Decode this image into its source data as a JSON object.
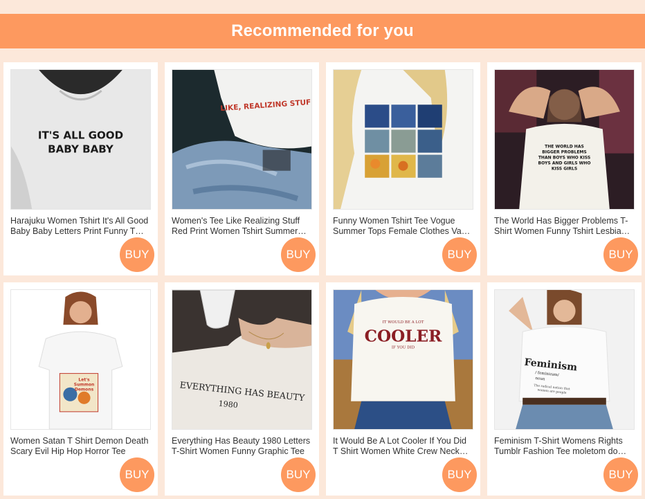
{
  "header": {
    "title": "Recommended for you"
  },
  "colors": {
    "accent": "#fd995f",
    "background": "#fce8da"
  },
  "products": [
    {
      "title": "Harajuku Women Tshirt It's All Good Baby Baby Letters Print Funny T Shirt",
      "buy_label": "BUY",
      "image_text": [
        "IT'S ALL GOOD",
        "BABY BABY"
      ]
    },
    {
      "title": "Women's Tee Like Realizing Stuff Red Print Women Tshirt Summer Casual",
      "buy_label": "BUY",
      "image_text": [
        "LIKE, REALIZING STUFF"
      ]
    },
    {
      "title": "Funny Women Tshirt Tee Vogue Summer Tops Female Clothes Van Gogh",
      "buy_label": "BUY",
      "image_text": []
    },
    {
      "title": "The World Has Bigger Problems T-Shirt Women Funny Tshirt Lesbian Pride",
      "buy_label": "BUY",
      "image_text": [
        "THE WORLD HAS",
        "BIGGER PROBLEMS",
        "THAN BOYS WHO KISS",
        "BOYS AND GIRLS WHO",
        "KISS GIRLS"
      ]
    },
    {
      "title": "Women Satan T Shirt Demon Death Scary Evil Hip Hop Horror Tee",
      "buy_label": "BUY",
      "image_text": [
        "Let's",
        "Summon",
        "Demons"
      ]
    },
    {
      "title": "Everything Has Beauty 1980 Letters T-Shirt Women Funny Graphic Tee",
      "buy_label": "BUY",
      "image_text": [
        "EVERYTHING HAS BEAUTY",
        "1980"
      ]
    },
    {
      "title": "It Would Be A Lot Cooler If You Did T Shirt Women White Crew Neck Tee",
      "buy_label": "BUY",
      "image_text": [
        "IT WOULD BE A LOT",
        "COOLER",
        "IF YOU DID"
      ]
    },
    {
      "title": "Feminism T-Shirt Womens Rights Tumblr Fashion Tee moletom do feminismo",
      "buy_label": "BUY",
      "image_text": [
        "Feminism",
        "/ feminizəm/",
        "noun",
        "The radical notion that",
        "women are people"
      ]
    }
  ]
}
